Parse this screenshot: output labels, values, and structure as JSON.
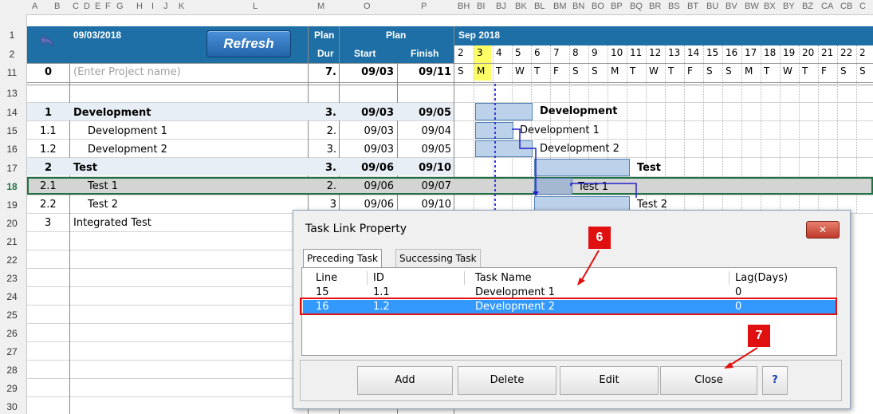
{
  "columns": [
    "A",
    "B",
    "C",
    "D",
    "E",
    "F",
    "G",
    "H",
    "I",
    "J",
    "K",
    "L",
    "M",
    "O",
    "P",
    "BH",
    "BI",
    "BJ",
    "BK",
    "BL",
    "BM",
    "BN",
    "BO",
    "BP",
    "BQ",
    "BR",
    "BS",
    "BT",
    "BU",
    "BV",
    "BW",
    "BX",
    "BY",
    "BZ",
    "CA",
    "CB",
    "C"
  ],
  "row_numbers": [
    "1",
    "2",
    "11",
    "13",
    "14",
    "15",
    "16",
    "17",
    "18",
    "19",
    "20",
    "21",
    "22",
    "23",
    "24",
    "25",
    "26",
    "27",
    "28",
    "29",
    "30"
  ],
  "header": {
    "date": "09/03/2018",
    "refresh_label": "Refresh",
    "plan_label": "Plan",
    "dur_label": "Dur",
    "plan_group_label": "Plan",
    "start_label": "Start",
    "finish_label": "Finish",
    "month_label": "Sep 2018"
  },
  "days": [
    "2",
    "3",
    "4",
    "5",
    "6",
    "7",
    "8",
    "9",
    "10",
    "11",
    "12",
    "13",
    "14",
    "15",
    "16",
    "17",
    "18",
    "19",
    "20",
    "21",
    "22",
    "2"
  ],
  "weekdays": [
    "S",
    "M",
    "T",
    "W",
    "T",
    "F",
    "S",
    "S",
    "M",
    "T",
    "W",
    "T",
    "F",
    "S",
    "S",
    "M",
    "T",
    "W",
    "T",
    "F",
    "S",
    "S"
  ],
  "project_row": {
    "id": "0",
    "name": "(Enter Project name)",
    "dur": "7.",
    "start": "09/03",
    "finish": "09/11"
  },
  "tasks": [
    {
      "id": "1",
      "name": "Development",
      "dur": "3.",
      "start": "09/03",
      "finish": "09/05",
      "bold": true
    },
    {
      "id": "1.1",
      "name": "Development 1",
      "dur": "2.",
      "start": "09/03",
      "finish": "09/04",
      "bold": false
    },
    {
      "id": "1.2",
      "name": "Development 2",
      "dur": "3.",
      "start": "09/03",
      "finish": "09/05",
      "bold": false
    },
    {
      "id": "2",
      "name": "Test",
      "dur": "3.",
      "start": "09/06",
      "finish": "09/10",
      "bold": true
    },
    {
      "id": "2.1",
      "name": "Test 1",
      "dur": "2.",
      "start": "09/06",
      "finish": "09/07",
      "bold": false
    },
    {
      "id": "2.2",
      "name": "Test 2",
      "dur": "3",
      "start": "09/06",
      "finish": "09/10",
      "bold": false
    },
    {
      "id": "3",
      "name": "Integrated Test",
      "dur": "",
      "start": "",
      "finish": "",
      "bold": false
    }
  ],
  "gantt_labels": {
    "development": "Development",
    "development_1": "Development 1",
    "development_2": "Development 2",
    "test": "Test",
    "test_1": "Test 1",
    "test_2": "Test 2"
  },
  "dialog": {
    "title": "Task Link Property",
    "tabs": [
      "Preceding Task",
      "Successing Task"
    ],
    "list_headers": [
      "Line",
      "ID",
      "Task Name",
      "Lag(Days)"
    ],
    "rows": [
      {
        "line": "15",
        "id": "1.1",
        "name": "Development 1",
        "lag": "0"
      },
      {
        "line": "16",
        "id": "1.2",
        "name": "Development 2",
        "lag": "0"
      }
    ],
    "buttons": [
      "Add",
      "Delete",
      "Edit",
      "Close",
      "?"
    ],
    "close_x": "✕"
  },
  "callouts": [
    "6",
    "7"
  ],
  "colors": {
    "header_blue": "#1f6fa7",
    "selected_row": "#3399ff",
    "highlight_red": "#e01010",
    "today_yellow": "#ffff66"
  }
}
